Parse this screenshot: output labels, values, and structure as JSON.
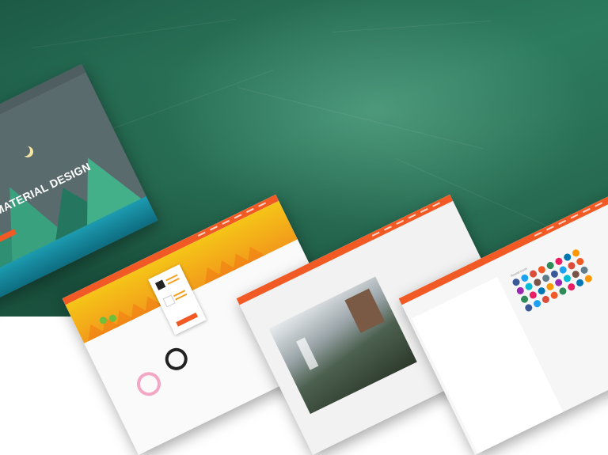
{
  "background": {
    "colors": [
      "#1d5a46",
      "#2a7a5e",
      "#164a39"
    ],
    "texture": "chalkboard"
  },
  "screens": [
    {
      "name": "material-design-landing",
      "headline": "ING NEW MATERIAL DESIGN",
      "nav_bg": "#4e5e61",
      "buttons": [
        "#f15a24",
        "#f4c20d"
      ],
      "mountains": [
        "#2e8f73",
        "#3aa17f",
        "#25765f",
        "#43b08a"
      ]
    },
    {
      "name": "ecommerce-product",
      "header_color": "#f15a24",
      "hero_colors": [
        "#f5c518",
        "#f29b1a"
      ],
      "products": [
        "pink-bracelet",
        "black-watch"
      ]
    },
    {
      "name": "photo-gallery",
      "header_color": "#f15a24"
    },
    {
      "name": "social-icons",
      "header_color": "#f15a24",
      "label": "Round Icons",
      "icon_colors": [
        "#3b5998",
        "#1da1f2",
        "#dd4b39",
        "#f15a24",
        "#2e8b57",
        "#e91e63",
        "#0077b5",
        "#ff9800",
        "#9c27b0",
        "#00bcd4",
        "#795548",
        "#607d8b"
      ]
    }
  ]
}
